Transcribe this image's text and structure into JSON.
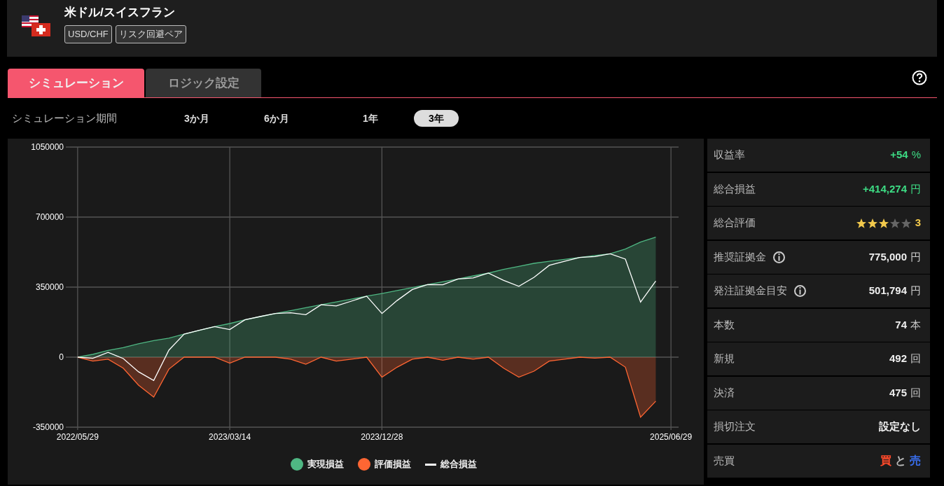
{
  "header": {
    "title": "米ドル/スイスフラン",
    "tags": [
      "USD/CHF",
      "リスク回避ペア"
    ]
  },
  "tabs": [
    {
      "label": "シミュレーション",
      "selected": true
    },
    {
      "label": "ロジック設定",
      "selected": false
    }
  ],
  "period": {
    "label": "シミュレーション期間",
    "options": [
      {
        "label": "3か月",
        "selected": false
      },
      {
        "label": "6か月",
        "selected": false
      },
      {
        "label": "1年",
        "selected": false
      },
      {
        "label": "3年",
        "selected": true
      }
    ]
  },
  "chart_data": {
    "type": "area",
    "categories": [
      "2022/05/29",
      null,
      null,
      null,
      null,
      null,
      null,
      null,
      null,
      null,
      "2023/03/14",
      null,
      null,
      null,
      null,
      null,
      null,
      null,
      null,
      null,
      "2023/12/28",
      null,
      null,
      null,
      null,
      null,
      null,
      null,
      null,
      null,
      null,
      null,
      null,
      null,
      null,
      null,
      null,
      null,
      null,
      "2025/06/29"
    ],
    "grid": true,
    "ylim": [
      -350000,
      1050000
    ],
    "yticks": [
      -350000,
      0,
      350000,
      700000,
      1050000
    ],
    "series": [
      {
        "name": "実現損益",
        "color": "#4fb783",
        "values": [
          0,
          14000,
          34000,
          48000,
          67000,
          83000,
          95000,
          115000,
          134000,
          153000,
          168000,
          187000,
          203000,
          218000,
          232000,
          247000,
          262000,
          276000,
          290000,
          305000,
          318000,
          333000,
          348000,
          363000,
          377000,
          391000,
          406000,
          420000,
          439000,
          454000,
          469000,
          479000,
          489000,
          498000,
          508000,
          517000,
          540000,
          575000,
          600000,
          null
        ]
      },
      {
        "name": "評価損益",
        "color": "#ff6633",
        "values": [
          0,
          -20000,
          -10000,
          -55000,
          -140000,
          -200000,
          -60000,
          0,
          0,
          0,
          -30000,
          0,
          0,
          0,
          -10000,
          -35000,
          0,
          -20000,
          -10000,
          0,
          -100000,
          -50000,
          -10000,
          0,
          -15000,
          0,
          -10000,
          0,
          -55000,
          -100000,
          -70000,
          -20000,
          -10000,
          0,
          -5000,
          0,
          -50000,
          -300000,
          -220000,
          null
        ]
      },
      {
        "name": "総合損益",
        "type": "line",
        "color": "#ffffff",
        "values": [
          0,
          -6000,
          24000,
          -7000,
          -73000,
          -117000,
          35000,
          115000,
          134000,
          153000,
          138000,
          187000,
          203000,
          218000,
          222000,
          212000,
          262000,
          256000,
          280000,
          305000,
          218000,
          283000,
          338000,
          363000,
          362000,
          391000,
          396000,
          420000,
          384000,
          354000,
          399000,
          459000,
          479000,
          498000,
          503000,
          517000,
          490000,
          275000,
          380000,
          null
        ]
      }
    ]
  },
  "stats": [
    {
      "kind": "value",
      "label": "収益率",
      "info": false,
      "value": "+54",
      "unit": "%",
      "highlight": true
    },
    {
      "kind": "value",
      "label": "総合損益",
      "info": false,
      "value": "+414,274",
      "unit": "円",
      "highlight": true
    },
    {
      "kind": "stars",
      "label": "総合評価",
      "info": false,
      "stars": 3,
      "value": "3"
    },
    {
      "kind": "value",
      "label": "推奨証拠金",
      "info": true,
      "value": "775,000",
      "unit": "円",
      "highlight": false
    },
    {
      "kind": "value",
      "label": "発注証拠金目安",
      "info": true,
      "value": "501,794",
      "unit": "円",
      "highlight": false
    },
    {
      "kind": "value",
      "label": "本数",
      "info": false,
      "value": "74",
      "unit": "本",
      "highlight": false
    },
    {
      "kind": "value",
      "label": "新規",
      "info": false,
      "value": "492",
      "unit": "回",
      "highlight": false
    },
    {
      "kind": "value",
      "label": "決済",
      "info": false,
      "value": "475",
      "unit": "回",
      "highlight": false
    },
    {
      "kind": "value",
      "label": "損切注文",
      "info": false,
      "value": "設定なし",
      "highlight": false
    },
    {
      "kind": "parts",
      "label": "売買",
      "info": false,
      "parts": [
        {
          "text": "買",
          "color": "#ff4a2a"
        },
        {
          "text": "と"
        },
        {
          "text": "売",
          "color": "#3a6ff0"
        }
      ]
    }
  ]
}
